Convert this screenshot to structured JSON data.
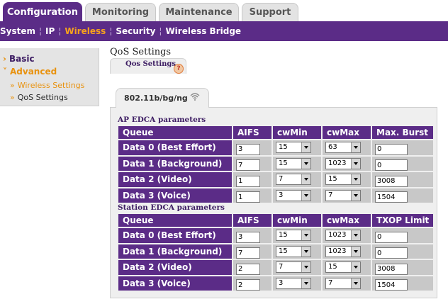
{
  "top_tabs": [
    {
      "label": "Configuration",
      "active": true
    },
    {
      "label": "Monitoring",
      "active": false
    },
    {
      "label": "Maintenance",
      "active": false
    },
    {
      "label": "Support",
      "active": false
    }
  ],
  "sub_nav": [
    "System",
    "IP",
    "Wireless",
    "Security",
    "Wireless Bridge"
  ],
  "sub_nav_active": "Wireless",
  "sidebar": {
    "basic": "Basic",
    "advanced": "Advanced",
    "wireless_settings": "Wireless Settings",
    "qos_settings": "QoS Settings"
  },
  "page": {
    "title": "QoS Settings",
    "help_tab": "Qos Settings",
    "help_icon": "?",
    "mode_tab": "802.11b/bg/ng"
  },
  "ap": {
    "label": "AP EDCA parameters",
    "headers": [
      "Queue",
      "AIFS",
      "cwMin",
      "cwMax",
      "Max. Burst"
    ],
    "rows": [
      {
        "queue": "Data 0 (Best Effort)",
        "aifs": "3",
        "cwmin": "15",
        "cwmax": "63",
        "last": "0"
      },
      {
        "queue": "Data 1 (Background)",
        "aifs": "7",
        "cwmin": "15",
        "cwmax": "1023",
        "last": "0"
      },
      {
        "queue": "Data 2 (Video)",
        "aifs": "1",
        "cwmin": "7",
        "cwmax": "15",
        "last": "3008"
      },
      {
        "queue": "Data 3 (Voice)",
        "aifs": "1",
        "cwmin": "3",
        "cwmax": "7",
        "last": "1504"
      }
    ]
  },
  "station": {
    "label": "Station EDCA parameters",
    "headers": [
      "Queue",
      "AIFS",
      "cwMin",
      "cwMax",
      "TXOP Limit"
    ],
    "rows": [
      {
        "queue": "Data 0 (Best Effort)",
        "aifs": "3",
        "cwmin": "15",
        "cwmax": "1023",
        "last": "0"
      },
      {
        "queue": "Data 1 (Background)",
        "aifs": "7",
        "cwmin": "15",
        "cwmax": "1023",
        "last": "0"
      },
      {
        "queue": "Data 2 (Video)",
        "aifs": "2",
        "cwmin": "7",
        "cwmax": "15",
        "last": "3008"
      },
      {
        "queue": "Data 3 (Voice)",
        "aifs": "2",
        "cwmin": "3",
        "cwmax": "7",
        "last": "1504"
      }
    ]
  },
  "colors": {
    "brand_purple": "#5b2c87",
    "accent_orange": "#f7a21c"
  },
  "icons": {
    "help": "help-icon",
    "wifi": "wifi-icon",
    "arrow": "arrow-right-icon"
  }
}
